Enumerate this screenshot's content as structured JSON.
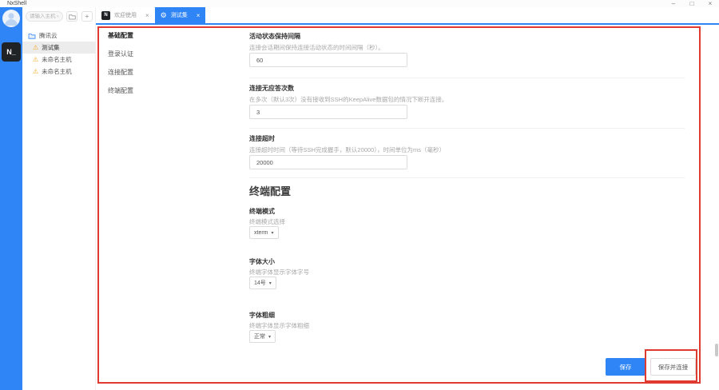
{
  "titlebar": {
    "app_title": "NxShell"
  },
  "icons": {
    "minimize": "–",
    "maximize": "□",
    "close": "×",
    "tab_close": "×",
    "gear": "⚙",
    "plus": "+",
    "host_warning": "⚠",
    "chevron_down": "▾"
  },
  "brand": {
    "logo": "N_",
    "tab_logo": "N"
  },
  "sidebar": {
    "search_placeholder": "请输入主机",
    "folder_label": "腾讯云",
    "hosts": [
      {
        "label": "测试集",
        "selected": true
      },
      {
        "label": "未命名主机",
        "selected": false
      },
      {
        "label": "未命名主机",
        "selected": false
      }
    ]
  },
  "tabs": {
    "welcome_label": "欢迎使用",
    "settings_label": "测试集"
  },
  "settings_nav": {
    "items": [
      {
        "label": "基础配置",
        "active": true
      },
      {
        "label": "登录认证",
        "active": false
      },
      {
        "label": "连接配置",
        "active": false
      },
      {
        "label": "终端配置",
        "active": false
      }
    ]
  },
  "form": {
    "sections": [
      {
        "title": "活动状态保持间隔",
        "desc": "连接会话期间保持连接活动状态的时间间隔（秒）。",
        "value": "60"
      },
      {
        "title": "连接无应答次数",
        "desc": "在多次（默认3次）没有接收到SSH的KeepAlive数据包的情况下断开连接。",
        "value": "3"
      },
      {
        "title": "连接超时",
        "desc": "连接超时时间（等待SSH完成握手，默认20000），时间单位为ms（毫秒）",
        "value": "20000"
      }
    ],
    "terminal_heading": "终端配置",
    "dropdowns": [
      {
        "title": "终端模式",
        "desc": "终端模式选择",
        "value": "xterm"
      },
      {
        "title": "字体大小",
        "desc": "终端字体显示字体字号",
        "value": "14号"
      },
      {
        "title": "字体粗细",
        "desc": "终端字体显示字体粗细",
        "value": "正常"
      }
    ],
    "buttons": {
      "save": "保存",
      "save_connect": "保存并连接"
    }
  },
  "colors": {
    "accent": "#2f84f6",
    "annotation": "#e0392f",
    "rail": "#2f84f6"
  }
}
